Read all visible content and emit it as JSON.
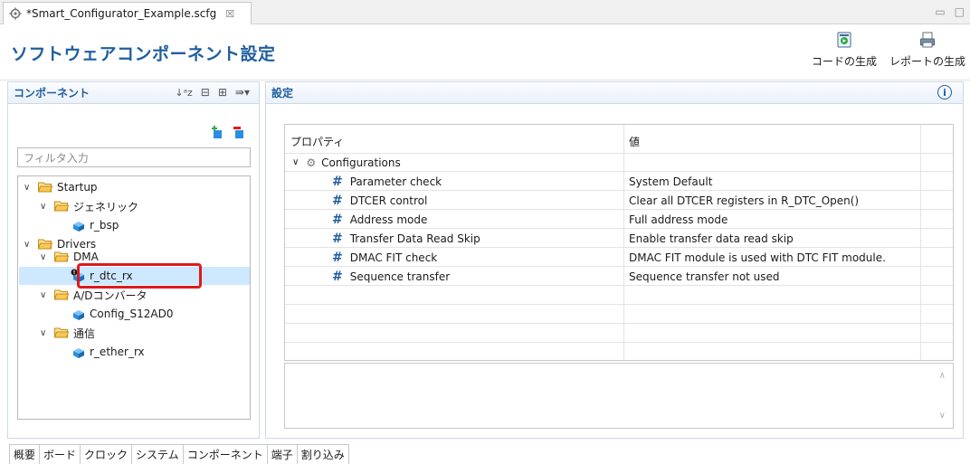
{
  "editor": {
    "tab_title": "*Smart_Configurator_Example.scfg",
    "close_glyph": "☒"
  },
  "header": {
    "title": "ソフトウェアコンポーネント設定",
    "generate_code_label": "コードの生成",
    "generate_report_label": "レポートの生成"
  },
  "component_panel": {
    "title": "コンポーネント",
    "filter_placeholder": "フィルタ入力",
    "tree": [
      {
        "label": "Startup"
      },
      {
        "label": "ジェネリック"
      },
      {
        "label": "r_bsp"
      },
      {
        "label": "Drivers"
      },
      {
        "label": "DMA"
      },
      {
        "label": "r_dtc_rx"
      },
      {
        "label": "A/Dコンバータ"
      },
      {
        "label": "Config_S12AD0"
      },
      {
        "label": "通信"
      },
      {
        "label": "r_ether_rx"
      }
    ]
  },
  "settings_panel": {
    "title": "設定",
    "col_property": "プロパティ",
    "col_value": "値",
    "group": "Configurations",
    "rows": [
      {
        "property": "Parameter check",
        "value": "System Default"
      },
      {
        "property": "DTCER control",
        "value": "Clear all DTCER registers in R_DTC_Open()"
      },
      {
        "property": "Address mode",
        "value": "Full address mode"
      },
      {
        "property": "Transfer Data Read Skip",
        "value": "Enable transfer data read skip"
      },
      {
        "property": "DMAC FIT check",
        "value": "DMAC FIT module is used with DTC FIT module."
      },
      {
        "property": "Sequence transfer",
        "value": "Sequence transfer not used"
      }
    ]
  },
  "bottom_tabs": [
    "概要",
    "ボード",
    "クロック",
    "システム",
    "コンポーネント",
    "端子",
    "割り込み"
  ],
  "colors": {
    "accent": "#1f5e9e",
    "selection": "#cde8ff",
    "highlight_box": "#e0191b",
    "folder": "#e8a21f",
    "cube": "#2a8de0"
  }
}
